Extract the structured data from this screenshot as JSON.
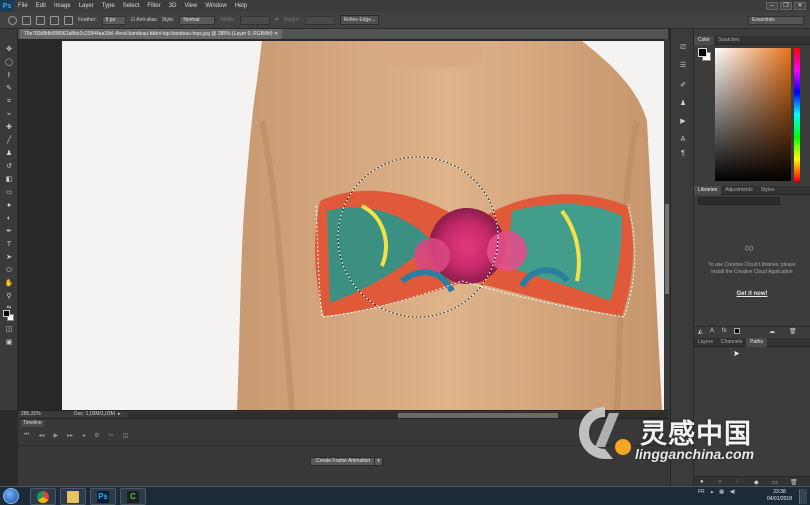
{
  "app": {
    "logo": "Ps"
  },
  "menu": [
    "File",
    "Edit",
    "Image",
    "Layer",
    "Type",
    "Select",
    "Filter",
    "3D",
    "View",
    "Window",
    "Help"
  ],
  "window_buttons": [
    "minimize-icon",
    "restore-icon",
    "close-icon"
  ],
  "options_bar": {
    "feather_label": "Feather:",
    "feather_value": "0 px",
    "anti_alias_label": "Anti-alias",
    "style_label": "Style:",
    "style_value": "Normal",
    "width_label": "Width:",
    "height_label": "Height:",
    "refine_edge": "Refine Edge...",
    "workspace": "Essentials"
  },
  "document": {
    "tab_title": "70e783d8db998962a8bb2c23944aa18d--floral-bandeau-bikini-top-bandeau-tops.jpg @ 285% (Layer 0, RGB/8#)",
    "zoom": "285,31%",
    "doc_info": "Doc: 1,03M/1,03M"
  },
  "timeline": {
    "tab": "Timeline",
    "create_button": "Create Frame Animation"
  },
  "color_panel": {
    "tabs": [
      "Color",
      "Swatches"
    ],
    "fg": "#000000",
    "bg": "#ffffff",
    "hue_color": "#e8731a"
  },
  "libraries_panel": {
    "tabs": [
      "Libraries",
      "Adjustments",
      "Styles"
    ],
    "message": "To use Creative Cloud Libraries, please install the Creative Cloud Application",
    "link": "Get it now!"
  },
  "layers_panel": {
    "tabs": [
      "Layers",
      "Channels",
      "Paths"
    ]
  },
  "taskbar": {
    "apps": [
      "windows-start-icon",
      "chrome-icon",
      "file-explorer-icon",
      "photoshop-icon",
      "camtasia-icon"
    ],
    "ps_label": "Ps",
    "cam_label": "C",
    "language": "FR",
    "time": "23:38",
    "date": "04/01/2018"
  },
  "watermark": {
    "cn_text": "灵感中国",
    "url": "lingganchina.com"
  }
}
